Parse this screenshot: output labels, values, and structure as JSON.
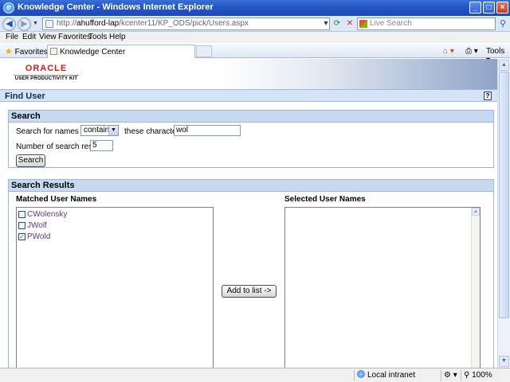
{
  "window": {
    "title": "Knowledge Center - Windows Internet Explorer",
    "controls": {
      "minimize": "_",
      "maximize": "□",
      "close": "×"
    }
  },
  "addressbar": {
    "url_prefix": "http://",
    "url_host": "ahufford-lap",
    "url_path": "/kcenter11/KP_ODS/pick/Users.aspx",
    "search_placeholder": "Live Search"
  },
  "menu": [
    "File",
    "Edit",
    "View",
    "Favorites",
    "Tools",
    "Help"
  ],
  "favbar": {
    "favorites_label": "Favorites",
    "tab_label": "Knowledge Center",
    "tools_label": "Tools"
  },
  "logo": {
    "brand": "ORACLE",
    "product": "USER PRODUCTIVITY KIT"
  },
  "page": {
    "title": "Find User",
    "help": "?",
    "search": {
      "heading": "Search",
      "names_label": "Search for names that",
      "operator": "contain",
      "chars_label": "these characters",
      "query": "wol",
      "count_label": "Number of search results",
      "count": "5",
      "button": "Search"
    },
    "results": {
      "heading": "Search Results",
      "matched_heading": "Matched User Names",
      "selected_heading": "Selected User Names",
      "add_button": "Add to list ->",
      "matched": [
        {
          "name": "CWolensky",
          "checked": false
        },
        {
          "name": "JWolf",
          "checked": false
        },
        {
          "name": "PWold",
          "checked": true
        }
      ],
      "selected": []
    }
  },
  "statusbar": {
    "zone": "Local intranet",
    "zoom": "100%"
  },
  "icons": {
    "back": "back-icon",
    "forward": "forward-icon",
    "refresh": "refresh-icon",
    "stop": "stop-icon",
    "home": "home-icon",
    "print": "print-icon",
    "help": "help-icon"
  }
}
